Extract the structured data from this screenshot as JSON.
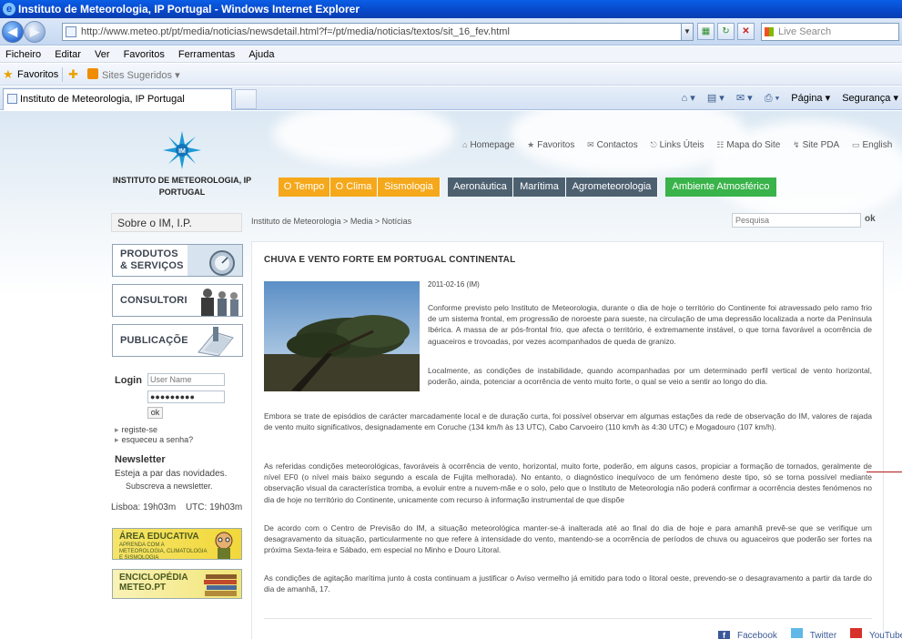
{
  "browser": {
    "window_title": "Instituto de Meteorologia, IP Portugal - Windows Internet Explorer",
    "url": "http://www.meteo.pt/pt/media/noticias/newsdetail.html?f=/pt/media/noticias/textos/sit_16_fev.html",
    "live_search_placeholder": "Live Search",
    "menu": [
      "Ficheiro",
      "Editar",
      "Ver",
      "Favoritos",
      "Ferramentas",
      "Ajuda"
    ],
    "favorites_label": "Favoritos",
    "suggested_sites_label": "Sites Sugeridos ▾",
    "tab_title": "Instituto de Meteorologia, IP Portugal",
    "command_bar": {
      "page": "Página ▾",
      "security": "Segurança ▾"
    }
  },
  "site": {
    "org_name_line1": "INSTITUTO DE METEOROLOGIA, IP",
    "org_name_line2": "PORTUGAL",
    "top_links": [
      "Homepage",
      "Favoritos",
      "Contactos",
      "Links Úteis",
      "Mapa do Site",
      "Site PDA",
      "English"
    ],
    "nav": {
      "group1": [
        "O Tempo",
        "O Clima",
        "Sismologia"
      ],
      "group2": [
        "Aeronáutica",
        "Marítima",
        "Agrometeorologia"
      ],
      "group3": [
        "Ambiente Atmosférico"
      ]
    },
    "sidebar": {
      "about": "Sobre o IM, I.P.",
      "boxes": [
        {
          "line1": "PRODUTOS",
          "line2": "& SERVIÇOS"
        },
        {
          "line1": "CONSULTORIA",
          "line2": ""
        },
        {
          "line1": "PUBLICAÇÕES",
          "line2": ""
        }
      ],
      "login": {
        "label": "Login",
        "username_placeholder": "User Name",
        "password_value": "●●●●●●●●●",
        "ok": "ok",
        "register": "registe-se",
        "forgot": "esqueceu a senha?"
      },
      "newsletter": {
        "title": "Newsletter",
        "text": "Esteja a par das novidades.",
        "subscribe": "Subscreva a newsletter."
      },
      "clock": {
        "lisboa_label": "Lisboa:",
        "lisboa_time": "19h03m",
        "utc_label": "UTC:",
        "utc_time": "19h03m"
      },
      "promo_edu": {
        "title": "ÁREA EDUCATIVA",
        "subtitle": "APRENDA COM A METEOROLOGIA, CLIMATOLOGIA E SISMOLOGIA"
      },
      "promo_enc": {
        "title1": "ENCICLOPÉDIA",
        "title2": "METEO.PT"
      }
    },
    "breadcrumb": "Instituto de Meteorologia > Media > Notícias",
    "search_placeholder": "Pesquisa",
    "search_ok": "ok",
    "article": {
      "title": "CHUVA E VENTO FORTE EM PORTUGAL CONTINENTAL",
      "date": "2011-02-16 (IM)",
      "paragraphs": [
        "Conforme previsto pelo Instituto de Meteorologia, durante o dia de hoje o território do Continente foi atravessado pelo ramo frio de um sistema frontal, em progressão de noroeste para sueste, na circulação de uma depressão localizada a norte da Península Ibérica. A massa de ar pós-frontal frio, que afecta o território, é extremamente instável, o que torna favorável a ocorrência de aguaceiros e trovoadas, por vezes acompanhados de queda de granizo.",
        "Localmente, as condições de instabilidade, quando acompanhadas por um determinado perfil vertical de vento horizontal, poderão, ainda, potenciar a ocorrência de vento muito forte, o qual se veio a sentir ao longo do dia.",
        "Embora se trate de episódios de carácter marcadamente local e de duração curta, foi possível observar em algumas estações da rede de observação do IM, valores de rajada de vento muito significativos, designadamente em Coruche (134 km/h às 13 UTC), Cabo Carvoeiro (110 km/h às 4:30 UTC) e Mogadouro (107 km/h).",
        "As referidas condições meteorológicas, favoráveis à ocorrência de vento, horizontal, muito forte, poderão, em alguns casos, propiciar a formação de tornados, geralmente de nível EF0 (o nível mais baixo segundo a escala de Fujita melhorada). No entanto, o diagnóstico inequívoco de um fenómeno deste tipo, só se torna possível mediante observação visual da característica tromba, a evoluir entre a nuvem-mãe e o solo, pelo que o Instituto de Meteorologia não poderá confirmar a ocorrência destes fenómenos no dia de hoje no território do Continente, unicamente com recurso à informação instrumental de que dispõe",
        "De acordo com o Centro de Previsão do IM, a situação meteorológica manter-se-á inalterada até ao final do dia de hoje e para amanhã prevê-se que se verifique um desagravamento da situação, particularmente no que refere à intensidade do vento, mantendo-se a ocorrência de períodos de chuva ou aguaceiros que poderão ser fortes na próxima Sexta-feira e Sábado, em especial no Minho e Douro Litoral.",
        "As condições de agitação marítima junto à costa continuam a justificar o Aviso vermelho já emitido para todo o litoral oeste, prevendo-se o desagravamento a partir da tarde do dia de amanhã, 17."
      ]
    },
    "social": [
      "Facebook",
      "Twitter",
      "YouTube"
    ]
  },
  "colors": {
    "nav_orange": "#f5a81b",
    "nav_slate": "#4d6070",
    "nav_green": "#39b34a",
    "ie_blue": "#0847c8"
  }
}
